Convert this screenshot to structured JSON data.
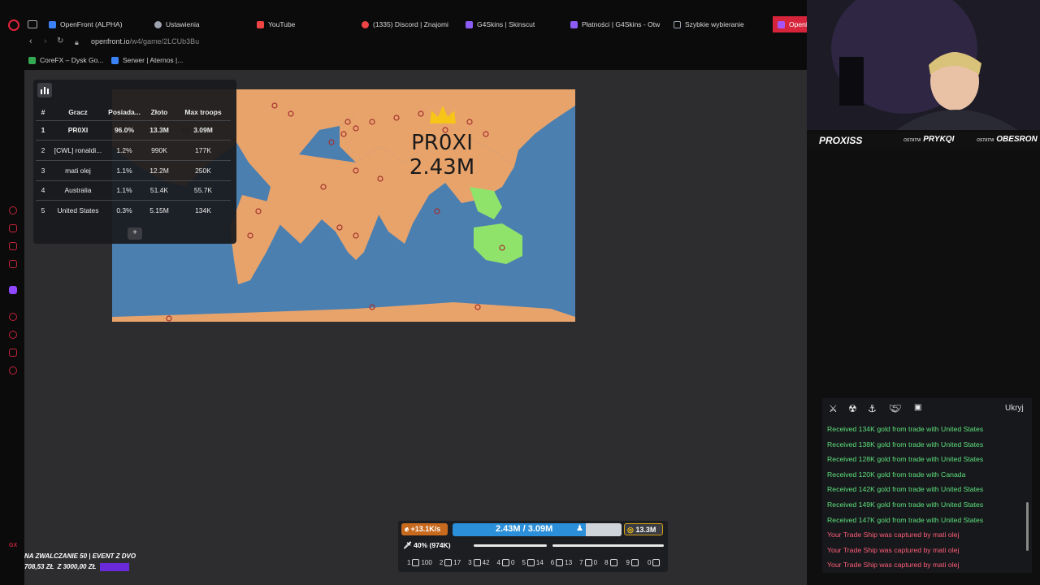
{
  "browser": {
    "tabs": [
      {
        "label": "OpenFront (ALPHA)",
        "favicon_color": "#3b82f6"
      },
      {
        "label": "Ustawienia",
        "favicon_color": "#9ca3af"
      },
      {
        "label": "YouTube",
        "favicon_color": "#ef4444"
      },
      {
        "label": "(1335) Discord | Znajomi",
        "favicon_color": "#ef4444"
      },
      {
        "label": "G4Skins | Skinscut",
        "favicon_color": "#8b5cf6"
      },
      {
        "label": "Płatności | G4Skins - Otw",
        "favicon_color": "#8b5cf6"
      },
      {
        "label": "Szybkie wybieranie",
        "favicon_color": "#9ca3af"
      },
      {
        "label": "OpenF",
        "favicon_color": "#a855f7"
      }
    ],
    "url_host": "openfront.io",
    "url_path": "/w4/game/2LCUb3Bu",
    "bookmarks": [
      {
        "label": "CoreFX – Dysk Go...",
        "favicon_color": "#34a853"
      },
      {
        "label": "Serwer | Aternos |...",
        "favicon_color": "#3b82f6"
      }
    ]
  },
  "game": {
    "player_label_name": "PR0XI",
    "player_label_troops": "2.43M",
    "leaderboard": {
      "headers": [
        "#",
        "Gracz",
        "Posiada...",
        "Złoto",
        "Max troops"
      ],
      "rows": [
        {
          "rank": "1",
          "name": "PR0XI",
          "owned": "96.0%",
          "gold": "13.3M",
          "max_troops": "3.09M",
          "me": true
        },
        {
          "rank": "2",
          "name": "[CWL] ronaldi...",
          "owned": "1.2%",
          "gold": "990K",
          "max_troops": "177K"
        },
        {
          "rank": "3",
          "name": "mati olej",
          "owned": "1.1%",
          "gold": "12.2M",
          "max_troops": "250K"
        },
        {
          "rank": "4",
          "name": "Australia",
          "owned": "1.1%",
          "gold": "51.4K",
          "max_troops": "55.7K"
        },
        {
          "rank": "5",
          "name": "United States",
          "owned": "0.3%",
          "gold": "5.15M",
          "max_troops": "134K"
        }
      ],
      "more_label": "+"
    },
    "events": {
      "hide_label": "Ukryj",
      "items": [
        {
          "text": "Received 134K gold from trade with United States",
          "kind": "good"
        },
        {
          "text": "Received 138K gold from trade with United States",
          "kind": "good"
        },
        {
          "text": "Received 128K gold from trade with United States",
          "kind": "good"
        },
        {
          "text": "Received 120K gold from trade with Canada",
          "kind": "good"
        },
        {
          "text": "Received 142K gold from trade with United States",
          "kind": "good"
        },
        {
          "text": "Received 149K gold from trade with United States",
          "kind": "good"
        },
        {
          "text": "Received 147K gold from trade with United States",
          "kind": "good"
        },
        {
          "text": "Your Trade Ship was captured by mati olej",
          "kind": "bad"
        },
        {
          "text": "Your Trade Ship was captured by mati olej",
          "kind": "bad"
        },
        {
          "text": "Your Trade Ship was captured by mati olej",
          "kind": "bad"
        }
      ]
    },
    "controls": {
      "troop_rate": "+13.1K/s",
      "troops": "2.43M / 3.09M",
      "gold": "13.3M",
      "attack_ratio": "40% (974K)",
      "troop_fill": 0.79,
      "builds": [
        {
          "key": "1",
          "count": "100"
        },
        {
          "key": "2",
          "count": "17"
        },
        {
          "key": "3",
          "count": "42"
        },
        {
          "key": "4",
          "count": "0"
        },
        {
          "key": "5",
          "count": "14"
        },
        {
          "key": "6",
          "count": "13"
        },
        {
          "key": "7",
          "count": "0"
        },
        {
          "key": "8",
          "count": ""
        },
        {
          "key": "9",
          "count": ""
        },
        {
          "key": "0",
          "count": ""
        }
      ]
    }
  },
  "stream": {
    "streamer": "PROXISS",
    "tag1_label": "OSTATNI",
    "tag1_name": "PRYKQI",
    "tag2_label": "OSTATNI",
    "tag2_name": "OBESRON",
    "donate_line1": "NA ZWALCZANIE 50 | EVENT Z DVO",
    "donate_line2_a": "708,53 ZŁ",
    "donate_line2_b": "Z 3000,00 ZŁ"
  },
  "colors": {
    "accent": "#d6253b",
    "ocean": "#4a7fb0",
    "land": "#e8a36b",
    "good": "#5de07d",
    "bad": "#ff5f7a"
  }
}
